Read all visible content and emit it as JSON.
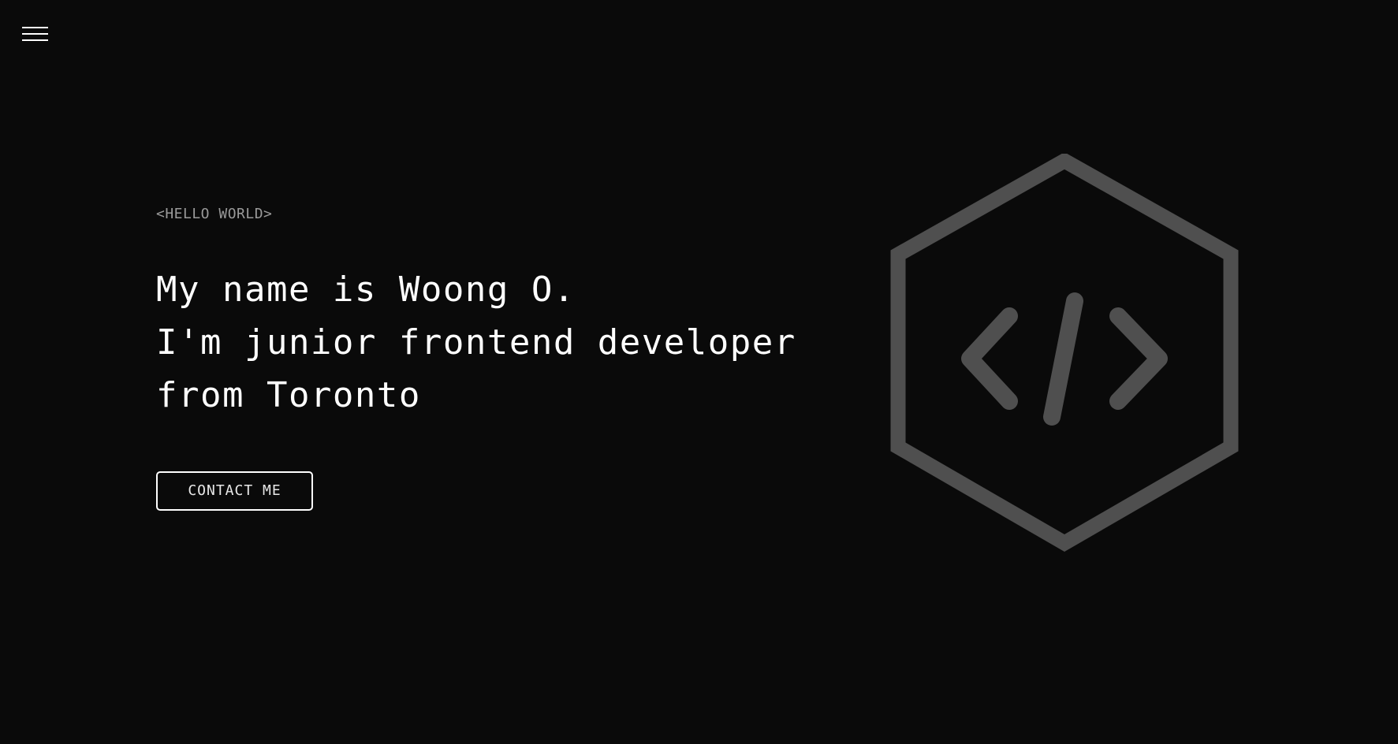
{
  "nav": {
    "menu_icon": "hamburger-menu-icon"
  },
  "hero": {
    "greeting": "<HELLO WORLD>",
    "headline_lines": [
      "My name is Woong O.",
      "I'm junior frontend developer",
      "from Toronto"
    ],
    "contact_label": "CONTACT ME"
  },
  "logo": {
    "icon": "code-hexagon-icon",
    "color": "#4f4f4f"
  },
  "colors": {
    "background": "#0a0a0a",
    "text": "#ffffff",
    "muted_text": "#9a9a9a",
    "logo": "#4f4f4f"
  }
}
